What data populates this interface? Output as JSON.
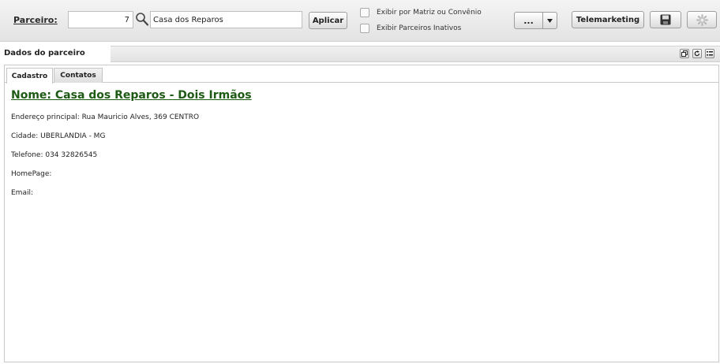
{
  "toolbar": {
    "parceiro_label": "Parceiro:",
    "code_value": "7",
    "name_value": "Casa dos Reparos",
    "apply_label": "Aplicar",
    "check_matriz_label": "Exibir por Matriz ou Convênio",
    "check_inativos_label": "Exibir Parceiros Inativos",
    "more_label": "...",
    "telemarketing_label": "Telemarketing",
    "icons": [
      "search-icon",
      "chevron-down-icon",
      "save-icon",
      "gear-icon"
    ]
  },
  "panel": {
    "title": "Dados do parceiro",
    "icons": [
      "restore-icon",
      "refresh-icon",
      "list-icon"
    ],
    "tabs": [
      {
        "label": "Cadastro",
        "active": true
      },
      {
        "label": "Contatos",
        "active": false
      }
    ]
  },
  "details": {
    "nome": "Nome: Casa dos Reparos - Dois Irmãos",
    "endereco": "Endereço principal: Rua Mauricio Alves, 369 CENTRO",
    "cidade": "Cidade: UBERLANDIA - MG",
    "telefone": "Telefone: 034 32826545",
    "homepage": "HomePage:",
    "email": "Email:"
  },
  "colors": {
    "nome_link": "#1d5a14",
    "toolbar_bg": "#e8e8e8"
  }
}
